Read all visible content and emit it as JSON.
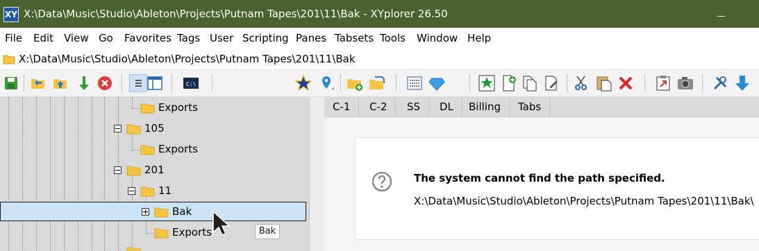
{
  "window": {
    "title": "X:\\Data\\Music\\Studio\\Ableton\\Projects\\Putnam Tapes\\201\\11\\Bak - XYplorer 26.50",
    "app_icon_text": "XY",
    "titlebar_color": "#48632d"
  },
  "menu": [
    "File",
    "Edit",
    "View",
    "Go",
    "Favorites",
    "Tags",
    "User",
    "Scripting",
    "Panes",
    "Tabsets",
    "Tools",
    "Window",
    "Help"
  ],
  "address": {
    "path": "X:\\Data\\Music\\Studio\\Ableton\\Projects\\Putnam Tapes\\201\\11\\Bak"
  },
  "toolbar": {
    "icons": [
      "save-icon",
      "sync-folders-icon",
      "folder-up-icon",
      "green-down-arrow-icon",
      "stop-icon",
      "list-view-icon",
      "dual-pane-icon",
      "console-icon",
      "favorite-star-icon",
      "location-pin-icon",
      "new-folder-icon",
      "folder-move-icon",
      "details-view-icon",
      "gem-icon",
      "star-tag-icon",
      "new-file-icon",
      "copy-icon",
      "edit-doc-icon",
      "cut-icon",
      "paste-icon",
      "delete-icon",
      "open-external-icon",
      "camera-icon",
      "tools-icon",
      "download-icon"
    ]
  },
  "tree": {
    "nodes": [
      {
        "label": "Exports",
        "expander": "none"
      },
      {
        "label": "105",
        "expander": "minus"
      },
      {
        "label": "Exports",
        "expander": "none"
      },
      {
        "label": "201",
        "expander": "minus"
      },
      {
        "label": "11",
        "expander": "minus"
      },
      {
        "label": "Bak",
        "expander": "plus",
        "selected": true
      },
      {
        "label": "Exports",
        "expander": "none"
      }
    ],
    "tooltip": "Bak"
  },
  "tabs": [
    "C-1",
    "C-2",
    "SS",
    "DL",
    "Billing",
    "Tabs"
  ],
  "error": {
    "message": "The system cannot find the path specified.",
    "path": "X:\\Data\\Music\\Studio\\Ableton\\Projects\\Putnam Tapes\\201\\11\\Bak\\"
  },
  "colors": {
    "selection": "#cce4f7",
    "tree_bg": "#d9d9d9",
    "folder": "#f5c542"
  }
}
